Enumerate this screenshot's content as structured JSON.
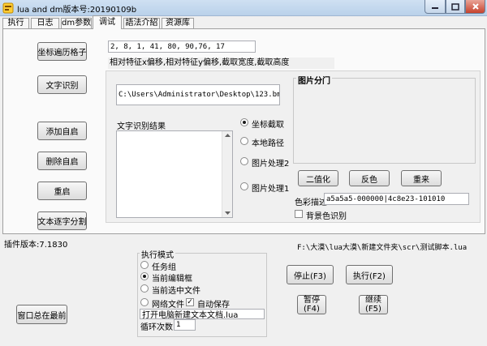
{
  "window": {
    "title": "lua and dm版本号:20190109b"
  },
  "tabs": [
    {
      "label": "执行"
    },
    {
      "label": "日志"
    },
    {
      "label": "dm参数"
    },
    {
      "label": "调试"
    },
    {
      "label": "語法介紹"
    },
    {
      "label": "资源库"
    }
  ],
  "left_buttons": {
    "traverse": "坐标遍历格子",
    "ocr": "文字识别",
    "add_autostart": "添加自启",
    "del_autostart": "删除自启",
    "restart": "重启",
    "text_split": "文本逐字分割"
  },
  "coords_input": {
    "value": "2, 8, 1, 41, 80, 90,76, 17"
  },
  "coords_hint": "相对特征x偏移,相对特征y偏移,截取宽度,截取高度",
  "image_path": {
    "value": "C:\\Users\\Administrator\\Desktop\\123.bmp"
  },
  "ocr_result_label": "文字识别结果",
  "radios": {
    "coord_capture": "坐标截取",
    "local_path": "本地路径",
    "img_proc2": "图片处理2",
    "img_proc1": "图片处理1"
  },
  "image_preview": {
    "label": "图片分门"
  },
  "image_buttons": {
    "binarize": "二值化",
    "invert": "反色",
    "reload": "重来"
  },
  "color_desc": {
    "label": "色彩描述",
    "value": "a5a5a5-000000|4c8e23-101010"
  },
  "bg_color_recog": "背景色识别",
  "plugin_version": "插件版本:7.1830",
  "script_path": "F:\\大漠\\lua大漠\\新建文件夹\\scr\\测试脚本.lua",
  "exec_mode": {
    "title": "执行模式",
    "task_group": "任务组",
    "current_editor": "当前编辑框",
    "current_selection": "当前选中文件",
    "network_file": "网络文件",
    "autosave": "自动保存",
    "open_text": "打开电脑新建文本文档.lua",
    "loop_label": "循环次数",
    "loop_value": "1"
  },
  "run_buttons": {
    "stop": "停止(F3)",
    "run": "执行(F2)",
    "pause_line1": "暂停",
    "pause_line2": "(F4)",
    "continue_line1": "继续",
    "continue_line2": "(F5)"
  },
  "always_on_top": "窗口总在最前"
}
